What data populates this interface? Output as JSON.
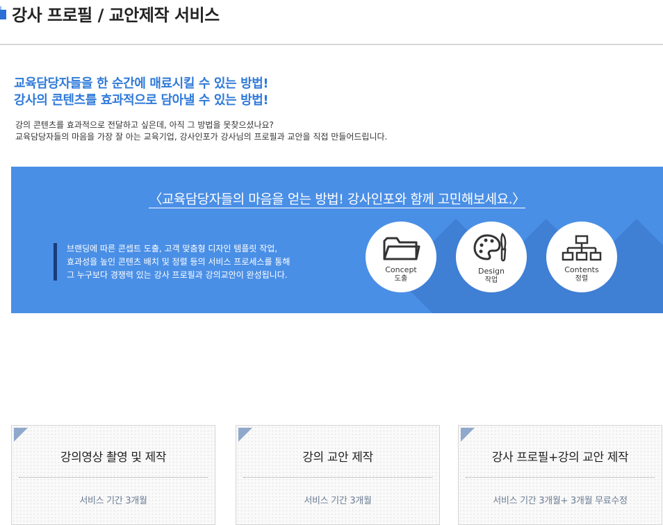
{
  "page": {
    "title": "강사 프로필 / 교안제작 서비스"
  },
  "headline": {
    "line1": "교육담당자들을 한 순간에 매료시킬 수 있는 방법!",
    "line2": "강사의 콘텐츠를 효과적으로 담아낼 수 있는 방법!"
  },
  "intro": {
    "line1": "강의 콘텐츠를 효과적으로 전달하고 싶은데, 아직 그 방법을 못찾으셨나요?",
    "line2": "교육담당자들의 마음을 가장 잘 아는 교육기업, 강사인포가 강사님의 프로필과 교안을 직접 만들어드립니다."
  },
  "banner": {
    "heading": "〈교육담당자들의 마음을 얻는 방법! 강사인포와 함께 고민해보세요.〉",
    "desc": [
      "브랜딩에 따른 콘셉트 도출, 고객 맞춤형 디자인 템플릿 작업,",
      "효과성을 높인 콘텐츠 배치 및 정렬 등의 서비스 프로세스를 통해",
      "그 누구보다 경쟁력 있는 강사 프로필과 강의교안이 완성됩니다."
    ],
    "steps": [
      {
        "en": "Concept",
        "ko": "도출",
        "icon": "folder-icon"
      },
      {
        "en": "Design",
        "ko": "작업",
        "icon": "palette-icon"
      },
      {
        "en": "Contents",
        "ko": "정렬",
        "icon": "hierarchy-icon"
      }
    ],
    "color": "#4a8fe6"
  },
  "cards": [
    {
      "title": "강의영상 촬영 및 제작",
      "sub": "서비스 기간 3개월"
    },
    {
      "title": "강의 교안 제작",
      "sub": "서비스 기간 3개월"
    },
    {
      "title": "강사 프로필+강의 교안 제작",
      "sub": "서비스 기간 3개월+ 3개월 무료수정"
    }
  ],
  "colors": {
    "accent": "#2f7ad9",
    "banner": "#4a8fe6",
    "card_sub": "#6b7c93"
  }
}
